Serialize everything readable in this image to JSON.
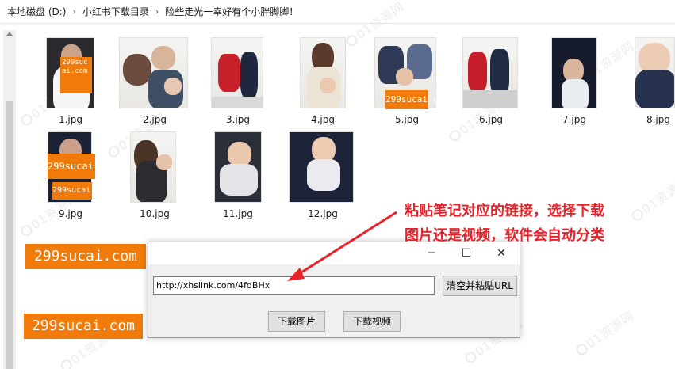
{
  "breadcrumb": {
    "items": [
      "本地磁盘 (D:)",
      "小红书下载目录",
      "险些走光一幸好有个小胖脚脚！"
    ],
    "separator": "›"
  },
  "files": [
    {
      "name": "1.jpg"
    },
    {
      "name": "2.jpg"
    },
    {
      "name": "3.jpg"
    },
    {
      "name": "4.jpg"
    },
    {
      "name": "5.jpg"
    },
    {
      "name": "6.jpg"
    },
    {
      "name": "7.jpg"
    },
    {
      "name": "8.jpg"
    },
    {
      "name": "9.jpg"
    },
    {
      "name": "10.jpg"
    },
    {
      "name": "11.jpg"
    },
    {
      "name": "12.jpg"
    }
  ],
  "dialog": {
    "url_value": "http://xhslink.com/4fdBHx",
    "clear_paste_label": "清空并粘贴URL",
    "download_images_label": "下载图片",
    "download_video_label": "下载视频",
    "minimize_icon": "─",
    "maximize_icon": "☐",
    "close_icon": "✕"
  },
  "annotation": {
    "line1": "粘贴笔记对应的链接，选择下载",
    "line2": "图片还是视频，软件会自动分类",
    "color": "#e8222a"
  },
  "watermarks": {
    "site_badge": "299sucai.com",
    "site_text": "01资源网"
  }
}
